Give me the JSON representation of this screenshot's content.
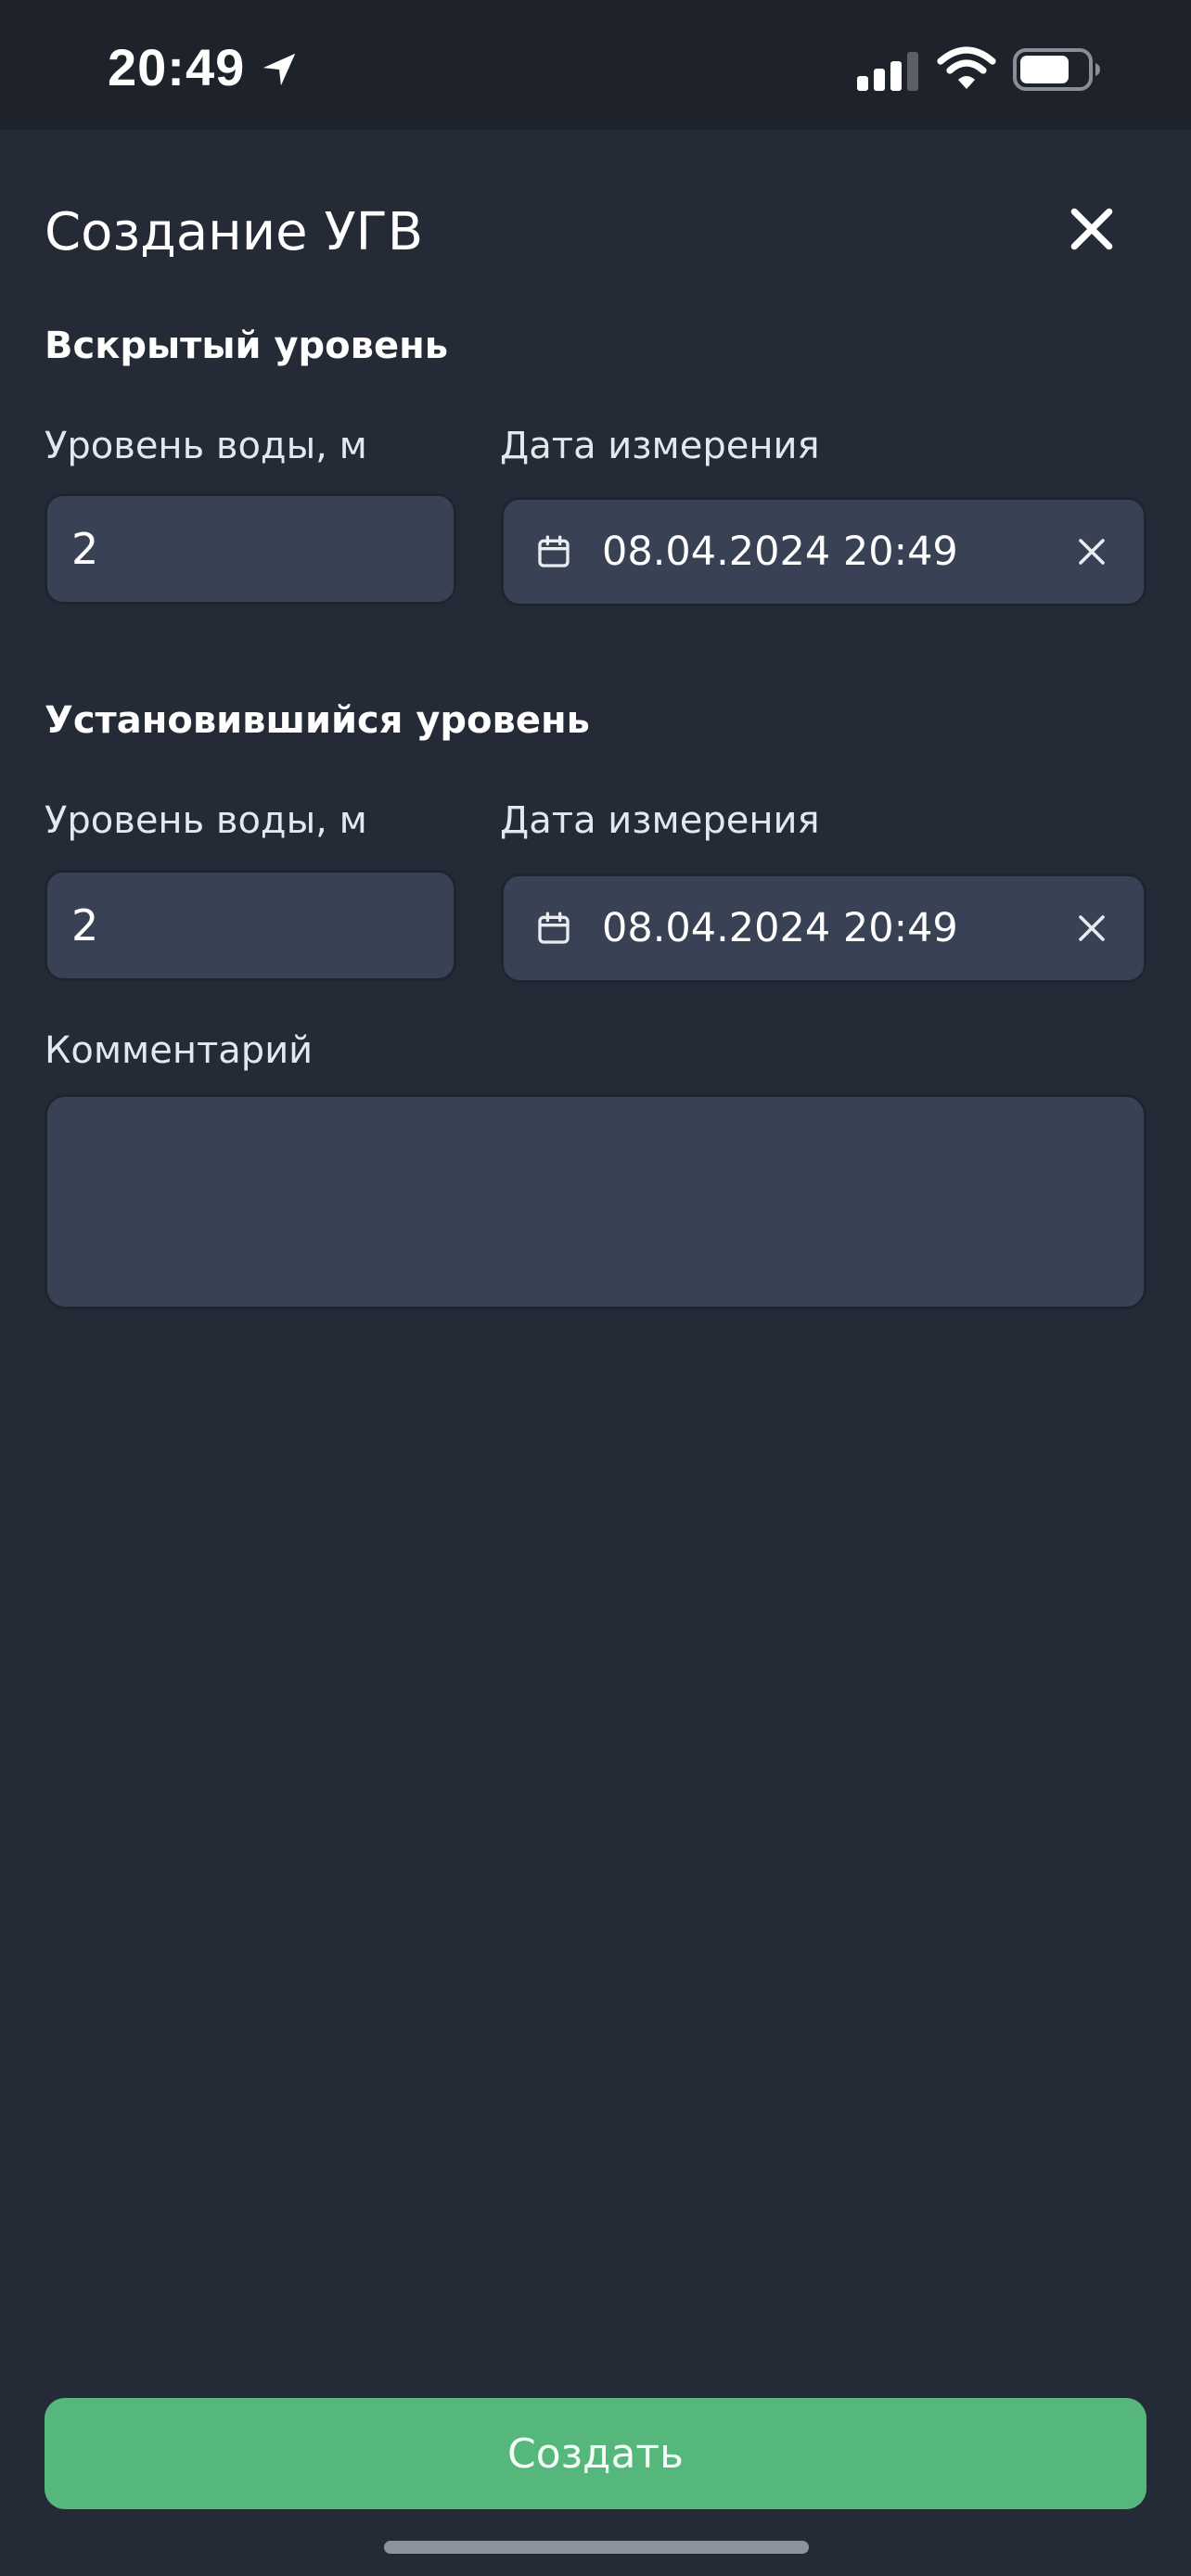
{
  "status_bar": {
    "time": "20:49",
    "icons": [
      "location-arrow-icon",
      "cellular-signal-icon",
      "wifi-icon",
      "battery-icon"
    ]
  },
  "header": {
    "title": "Создание УГВ",
    "close_icon": "close-icon"
  },
  "exposed_level": {
    "section_title": "Вскрытый уровень",
    "water_level_label": "Уровень воды, м",
    "water_level_value": "2",
    "date_label": "Дата измерения",
    "date_value": "08.04.2024 20:49"
  },
  "steady_level": {
    "section_title": "Установившийся уровень",
    "water_level_label": "Уровень воды, м",
    "water_level_value": "2",
    "date_label": "Дата измерения",
    "date_value": "08.04.2024 20:49"
  },
  "comment": {
    "label": "Комментарий",
    "value": ""
  },
  "footer": {
    "create_label": "Создать"
  },
  "colors": {
    "background": "#252b36",
    "field": "#394255",
    "accent_button": "#55b77c"
  }
}
